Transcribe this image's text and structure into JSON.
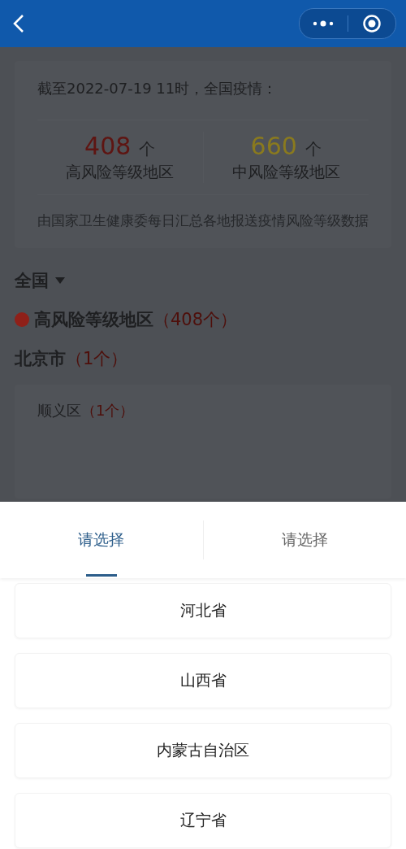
{
  "summary": {
    "title": "截至2022-07-19 11时，全国疫情：",
    "stats": [
      {
        "value": "408",
        "unit": "个",
        "label": "高风险等级地区",
        "color": "#5e1512"
      },
      {
        "value": "660",
        "unit": "个",
        "label": "中风险等级地区",
        "color": "#8a7a1e"
      }
    ],
    "note": "由国家卫生健康委每日汇总各地报送疫情风险等级数据"
  },
  "scope": {
    "label": "全国"
  },
  "level": {
    "label": "高风险等级地区",
    "count": "（408个）",
    "color": "#8f2019"
  },
  "city": {
    "name": "北京市",
    "count": "（1个）"
  },
  "districts": [
    {
      "name": "顺义区",
      "count": "（1个）"
    }
  ],
  "sheet": {
    "tabs": [
      {
        "label": "请选择",
        "selected": true
      },
      {
        "label": "请选择",
        "selected": false
      }
    ],
    "options": [
      "河北省",
      "山西省",
      "内蒙古自治区",
      "辽宁省"
    ]
  }
}
